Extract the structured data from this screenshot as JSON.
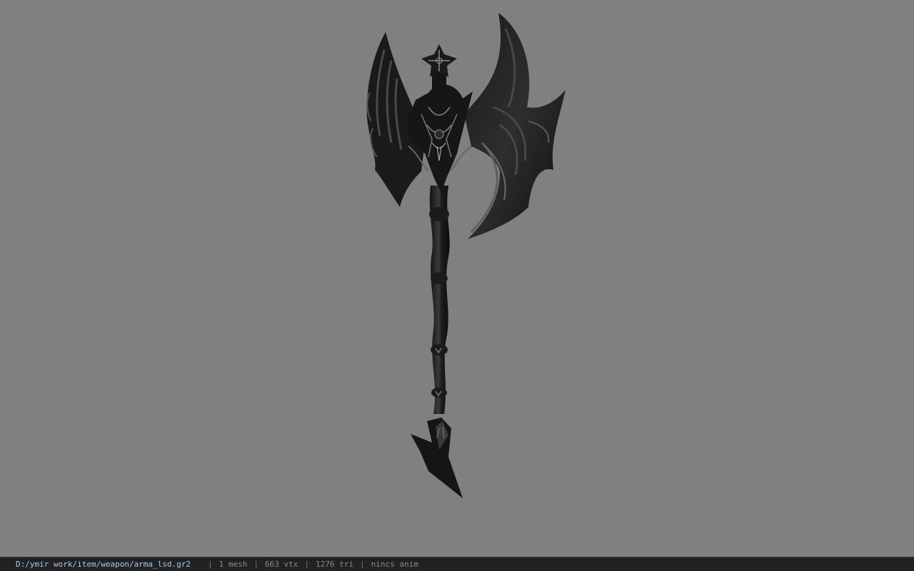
{
  "viewer": {
    "background_color": "#808080",
    "model_description": "black ornate battle axe"
  },
  "status": {
    "file_path": "D:/ymir work/item/weapon/arma_lsd.gr2",
    "separator": "|",
    "mesh_count": "1 mesh",
    "vertex_count": "663 vtx",
    "triangle_count": "1276 tri",
    "animation": "nincs anim"
  }
}
